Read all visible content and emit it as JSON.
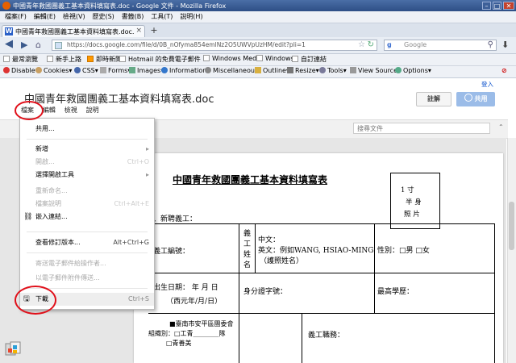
{
  "window": {
    "title": "中國青年救國團義工基本資料填寫表.doc - Google 文件 - Mozilla Firefox"
  },
  "browser_menu": [
    "檔案(F)",
    "編輯(E)",
    "檢視(V)",
    "歷史(S)",
    "書籤(B)",
    "工具(T)",
    "說明(H)"
  ],
  "tab": {
    "label": "中國青年救國團義工基本資料填寫表.doc…",
    "favicon": "W"
  },
  "new_tab_label": "+",
  "address": {
    "url": "https://docs.google.com/file/d/0B_nOfyma854emlNz2O5UWVpUzHM/edit?pli=1",
    "search_placeholder": "Google",
    "search_engine": "g"
  },
  "bookmarks": [
    "最常瀏覽",
    "新手上路",
    "即時新聞",
    "Hotmail 的免費電子郵件",
    "Windows Media",
    "Windows",
    "自訂連結"
  ],
  "devbar": [
    "Disable▾",
    "Cookies▾",
    "CSS▾",
    "Forms▾",
    "Images▾",
    "Information▾",
    "Miscellaneous▾",
    "Outline▾",
    "Resize▾",
    "Tools▾",
    "View Source▾",
    "Options▾"
  ],
  "docs": {
    "sign_in": "登入",
    "doc_title": "中國青年救國團義工基本資料填寫表.doc",
    "menu": [
      "檔案",
      "編輯",
      "檢視",
      "說明"
    ],
    "comment_button": "註解",
    "share_button": "共用",
    "search_docs_placeholder": "搜尋文件",
    "collapse": "⌃"
  },
  "file_menu": {
    "items": [
      {
        "label": "共用...",
        "shortcut": "",
        "disabled": false
      },
      {
        "label": "新增",
        "shortcut": "▸",
        "disabled": false
      },
      {
        "label": "開啟...",
        "shortcut": "Ctrl+O",
        "disabled": true
      },
      {
        "label": "選擇開啟工具",
        "shortcut": "▸",
        "disabled": false
      },
      {
        "label": "重新命名...",
        "shortcut": "",
        "disabled": true
      },
      {
        "label": "檔案說明",
        "shortcut": "Ctrl+Alt+E",
        "disabled": true
      },
      {
        "label": "嵌入連結...",
        "shortcut": "",
        "disabled": false
      },
      {
        "label": "查看修訂版本...",
        "shortcut": "Alt+Ctrl+G",
        "disabled": false
      },
      {
        "label": "寄送電子郵件給操作者...",
        "shortcut": "",
        "disabled": true
      },
      {
        "label": "以電子郵件附件傳送...",
        "shortcut": "",
        "disabled": true
      },
      {
        "label": "下載",
        "shortcut": "Ctrl+S",
        "disabled": false
      }
    ]
  },
  "document": {
    "form_title": "中國青年救國團義工基本資料填寫表",
    "photo_box": [
      "1 寸",
      "半 身",
      "照 片"
    ],
    "section_label": "、新聘義工：",
    "volunteer_id": "義工編號：",
    "name_label": [
      "義",
      "工",
      "姓",
      "名"
    ],
    "chinese_name": "中文：",
    "english_name": "英文：例如WANG, HSIAO-MING",
    "english_note": "（護照姓名）",
    "gender": "性別：□男  □女",
    "birth": "出生日期：  年  月  日",
    "birth_note": "（西元年/月/日）",
    "id_number": "身分證字號：",
    "education": "最高學歷：",
    "org_line1": "■臺南市安平區團委會",
    "org_line2": "組織別：□工青________隊",
    "org_line3": "□青善美",
    "volunteer_role": "義工職務："
  }
}
